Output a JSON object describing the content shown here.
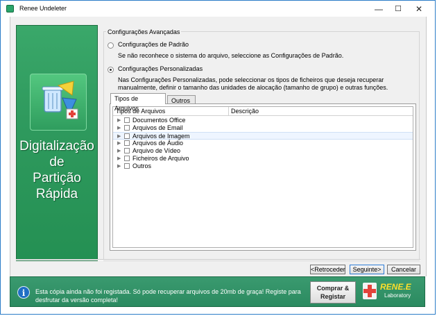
{
  "window": {
    "title": "Renee Undeleter",
    "minimize": "—",
    "maximize": "☐",
    "close": "✕"
  },
  "left_panel": {
    "title_lines": [
      "Digitalização",
      "de",
      "Partição",
      "Rápida"
    ]
  },
  "advanced": {
    "group_label": "Configurações Avançadas",
    "default_option": {
      "label": "Configurações de Padrão",
      "description": "Se não reconhece o sistema do arquivo, seleccione as Configurações de Padrão.",
      "selected": false
    },
    "custom_option": {
      "label": "Configurações Personalizadas",
      "description": "Nas Configurações Personalizadas, pode seleccionar os tipos de ficheiros que deseja recuperar manualmente, definir o tamanho das unidades de alocação (tamanho de grupo) e outras funções.",
      "selected": true
    }
  },
  "tabs": [
    {
      "label": "Tipos de Arquivos",
      "active": true
    },
    {
      "label": "Outros",
      "active": false
    }
  ],
  "tree": {
    "columns": [
      "Tipos de Arquivos",
      "Descrição"
    ],
    "rows": [
      {
        "label": "Documentos Office",
        "checked": false
      },
      {
        "label": "Arquivos de Email",
        "checked": false
      },
      {
        "label": "Arquivos de Imagem",
        "checked": false,
        "highlighted": true
      },
      {
        "label": "Arquivos de Áudio",
        "checked": false
      },
      {
        "label": "Arquivo de Vídeo",
        "checked": false
      },
      {
        "label": "Ficheiros de Arquivo",
        "checked": false
      },
      {
        "label": "Outros",
        "checked": false
      }
    ]
  },
  "buttons": {
    "back": "<Retroceder",
    "next": "Seguinte>",
    "cancel": "Cancelar"
  },
  "banner": {
    "message": "Esta cópia ainda não foi registada. Só pode recuperar arquivos de 20mb de graça! Registe para desfrutar da versão completa!",
    "buy_line1": "Comprar &",
    "buy_line2": "Registar",
    "logo_name": "RENE.E",
    "logo_sub": "Laboratory"
  },
  "colors": {
    "panel_green": "#2f9a5e",
    "banner_green": "#2b8a60",
    "logo_yellow": "#ffdf2b",
    "logo_red": "#e2433a"
  }
}
